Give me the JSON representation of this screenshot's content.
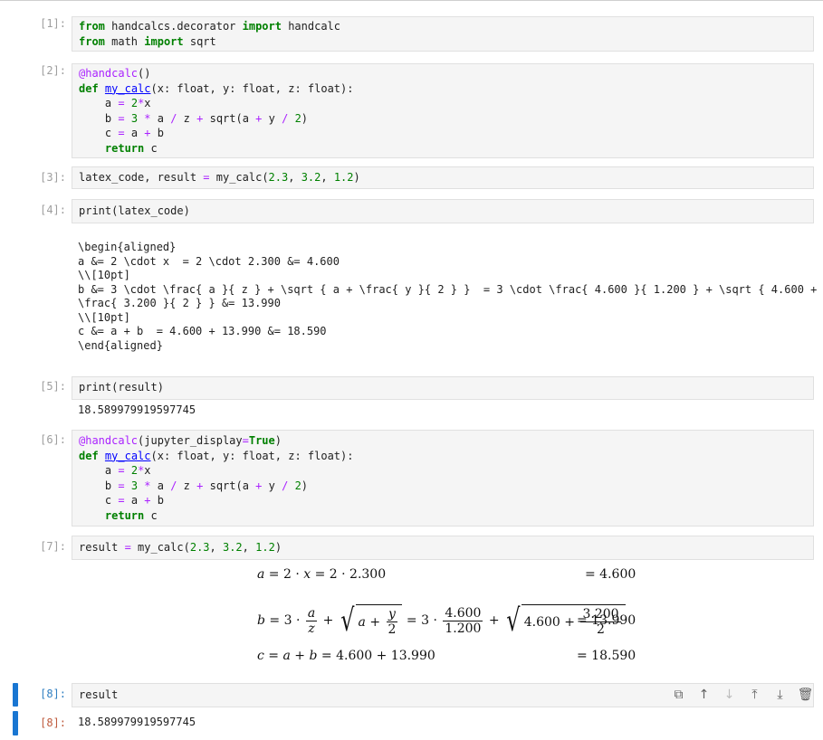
{
  "cells": [
    {
      "in_prompt": "[1]:"
    },
    {
      "in_prompt": "[2]:"
    },
    {
      "in_prompt": "[3]:"
    },
    {
      "in_prompt": "[4]:",
      "output": "\\begin{aligned}\na &= 2 \\cdot x  = 2 \\cdot 2.300 &= 4.600\n\\\\[10pt]\nb &= 3 \\cdot \\frac{ a }{ z } + \\sqrt { a + \\frac{ y }{ 2 } }  = 3 \\cdot \\frac{ 4.600 }{ 1.200 } + \\sqrt { 4.600 +\n\\frac{ 3.200 }{ 2 } } &= 13.990\n\\\\[10pt]\nc &= a + b  = 4.600 + 13.990 &= 18.590\n\\end{aligned}"
    },
    {
      "in_prompt": "[5]:",
      "output": "18.589979919597745"
    },
    {
      "in_prompt": "[6]:"
    },
    {
      "in_prompt": "[7]:"
    },
    {
      "in_prompt": "[8]:",
      "out_prompt": "[8]:",
      "output": "18.589979919597745"
    }
  ],
  "code": {
    "c1": {
      "l1": [
        "from",
        " handcalcs.decorator ",
        "import",
        " handcalc"
      ],
      "l2": [
        "from",
        " math ",
        "import",
        " sqrt"
      ]
    },
    "c3": "latex_code, result = my_calc(2.3, 3.2, 1.2)",
    "c4": "print(latex_code)",
    "c5": "print(result)",
    "c7": "result = my_calc(2.3, 3.2, 1.2)",
    "c8": "result"
  },
  "math": {
    "a_result": "= 4.600",
    "b_result": "= 13.990",
    "c_result": "= 18.590"
  },
  "toolbar": [
    "copy-icon",
    "move-up-icon",
    "move-down-icon",
    "insert-above-icon",
    "insert-below-icon",
    "delete-icon"
  ]
}
